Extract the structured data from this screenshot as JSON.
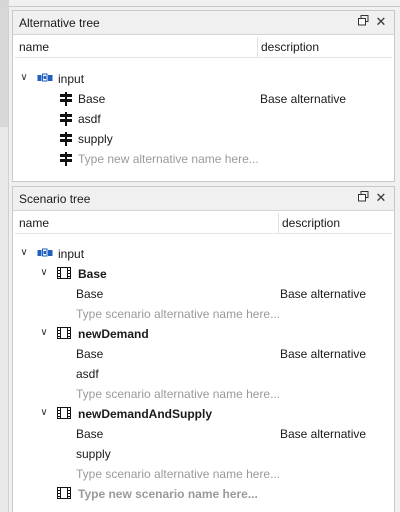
{
  "alternative_tree": {
    "title": "Alternative tree",
    "columns": {
      "name": "name",
      "description": "description"
    },
    "root": {
      "label": "input"
    },
    "items": [
      {
        "name": "Base",
        "description": "Base alternative"
      },
      {
        "name": "asdf",
        "description": ""
      },
      {
        "name": "supply",
        "description": ""
      }
    ],
    "new_placeholder": "Type new alternative name here..."
  },
  "scenario_tree": {
    "title": "Scenario tree",
    "columns": {
      "name": "name",
      "description": "description"
    },
    "root": {
      "label": "input"
    },
    "scenarios": [
      {
        "name": "Base",
        "alternatives": [
          {
            "name": "Base",
            "description": "Base alternative"
          }
        ],
        "placeholder": "Type scenario alternative name here..."
      },
      {
        "name": "newDemand",
        "alternatives": [
          {
            "name": "Base",
            "description": "Base alternative"
          },
          {
            "name": "asdf",
            "description": ""
          }
        ],
        "placeholder": "Type scenario alternative name here..."
      },
      {
        "name": "newDemandAndSupply",
        "alternatives": [
          {
            "name": "Base",
            "description": "Base alternative"
          },
          {
            "name": "supply",
            "description": ""
          }
        ],
        "placeholder": "Type scenario alternative name here..."
      }
    ],
    "new_placeholder": "Type new scenario name here..."
  },
  "icons": {
    "float": "float-window-icon",
    "close": "close-icon",
    "database": "database-icon",
    "alternative": "signpost-icon",
    "scenario": "film-strip-icon"
  },
  "colors": {
    "database_blue": "#1f5fbf",
    "placeholder": "#9a9a9a"
  }
}
